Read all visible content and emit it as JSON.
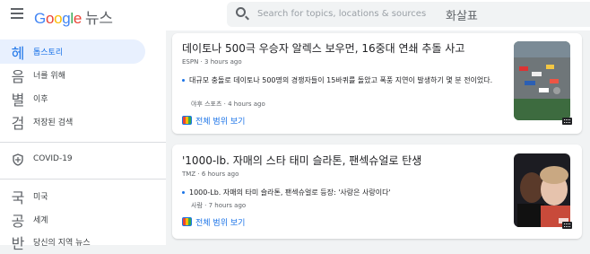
{
  "header": {
    "logo": "Google",
    "product": "뉴스",
    "search_placeholder": "Search for topics, locations & sources",
    "search_overlay": "화살표"
  },
  "sidebar": {
    "items": [
      {
        "icon": "헤",
        "label": "톱스토리"
      },
      {
        "icon": "음",
        "label": "너를 위해"
      },
      {
        "icon": "별",
        "label": "이후"
      },
      {
        "icon": "검",
        "label": "저장된 검색"
      },
      {
        "icon": "shield-icon",
        "label": "COVID-19"
      },
      {
        "icon": "국",
        "label": "미국"
      },
      {
        "icon": "공",
        "label": "세계"
      },
      {
        "icon": "반",
        "label": "당신의 지역 뉴스"
      }
    ]
  },
  "articles": [
    {
      "title": "데이토나 500극 우승자 알렉스 보우먼, 16중대 연쇄 추돌 사고",
      "source": "ESPN",
      "time": "3 hours ago",
      "sub_text": "대규모 충돌로 데이토나 500명의 경쟁자들이 15바퀴를 돌았고 폭풍 지연이 발생하기 몇 분 전이었다.",
      "sub_source": "야후 스포츠",
      "sub_time": "4 hours ago",
      "coverage": "전체 범위 보기"
    },
    {
      "title": "'1000-lb. 자매의 스타 태미 슬라톤, 팬섹슈얼로 탄생",
      "source": "TMZ",
      "time": "6 hours ago",
      "sub_text": "1000-Lb. 자매의 타미 슬라톤, 팬섹슈얼로 등장: '사랑은 사랑이다'",
      "sub_source": "사람",
      "sub_time": "7 hours ago",
      "coverage": "전체 범위 보기"
    }
  ],
  "colors": {
    "accent": "#1a73e8",
    "active_bg": "#e8f0fe",
    "page_bg": "#f1f3f4"
  }
}
